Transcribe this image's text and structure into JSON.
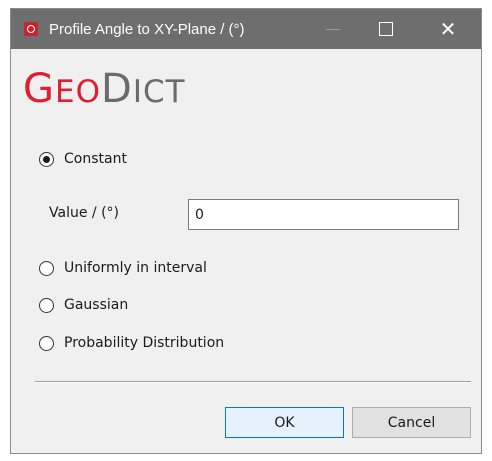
{
  "window": {
    "title": "Profile Angle to XY-Plane / (°)",
    "icons": {
      "app": "geodict-app-icon",
      "minimize": "minimize-icon",
      "maximize": "maximize-icon",
      "close": "close-icon"
    },
    "close_glyph": "✕"
  },
  "logo": {
    "geo_cap": "G",
    "geo_rest": "EO",
    "dict_cap": "D",
    "dict_rest": "ICT"
  },
  "options": {
    "constant": {
      "label": "Constant",
      "checked": true
    },
    "uniform": {
      "label": "Uniformly in interval",
      "checked": false
    },
    "gaussian": {
      "label": "Gaussian",
      "checked": false
    },
    "probability": {
      "label": "Probability Distribution",
      "checked": false
    }
  },
  "value_field": {
    "label": "Value / (°)",
    "value": "0"
  },
  "buttons": {
    "ok": "OK",
    "cancel": "Cancel"
  },
  "colors": {
    "titlebar": "#6e6e6e",
    "logo_red": "#e01f2e",
    "logo_gray": "#6b6b6b",
    "ok_border": "#0078d7"
  }
}
